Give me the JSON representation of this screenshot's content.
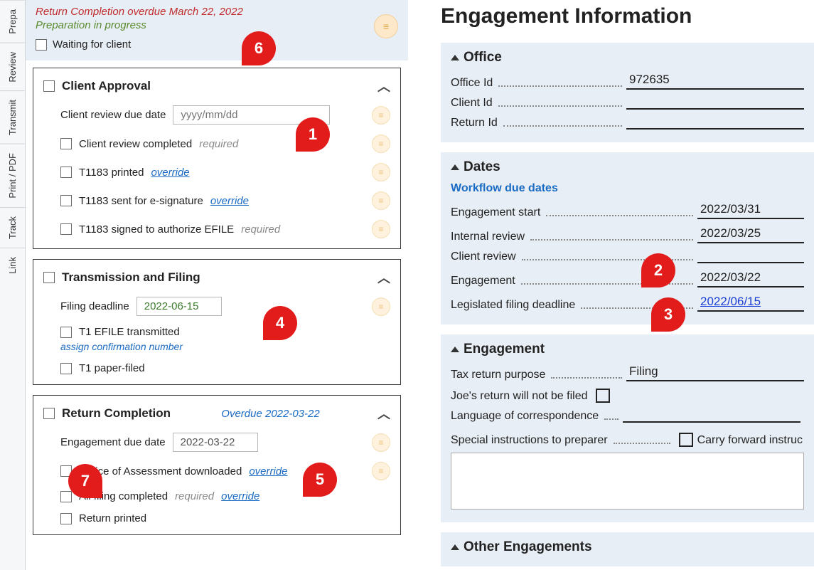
{
  "sideTabs": {
    "prepare": "Prepa",
    "review": "Review",
    "transmit": "Transmit",
    "printpdf": "Print / PDF",
    "track": "Track",
    "link": "Link"
  },
  "topStatus": {
    "overdue": "Return Completion overdue March 22, 2022",
    "progress": "Preparation in progress",
    "waiting": "Waiting for client"
  },
  "clientApproval": {
    "title": "Client Approval",
    "reviewDueLabel": "Client review due date",
    "reviewDuePlaceholder": "yyyy/mm/dd",
    "completed": "Client review completed",
    "t1183printed": "T1183 printed",
    "t1183esig": "T1183 sent for e-signature",
    "t1183signed": "T1183 signed to authorize EFILE",
    "required": "required",
    "override": "override"
  },
  "transmission": {
    "title": "Transmission and Filing",
    "deadlineLabel": "Filing deadline",
    "deadlineValue": "2022-06-15",
    "efile": "T1 EFILE transmitted",
    "assign": "assign confirmation number",
    "paper": "T1 paper-filed"
  },
  "completion": {
    "title": "Return Completion",
    "status": "Overdue 2022-03-22",
    "dueLabel": "Engagement due date",
    "dueValue": "2022-03-22",
    "noa": "Notice of Assessment downloaded",
    "allfiling": "All filing completed",
    "printed": "Return printed",
    "required": "required",
    "override": "override"
  },
  "info": {
    "heading": "Engagement Information",
    "office": {
      "title": "Office",
      "officeId": "Office Id",
      "officeIdVal": "972635",
      "clientId": "Client Id",
      "clientIdVal": "",
      "returnId": "Return Id",
      "returnIdVal": ""
    },
    "dates": {
      "title": "Dates",
      "sub": "Workflow due dates",
      "engStart": "Engagement start",
      "engStartVal": "2022/03/31",
      "internal": "Internal review",
      "internalVal": "2022/03/25",
      "clientReview": "Client review",
      "clientReviewVal": "",
      "engagement": "Engagement",
      "engagementVal": "2022/03/22",
      "legisl": "Legislated filing deadline",
      "legislVal": "2022/06/15"
    },
    "engagement": {
      "title": "Engagement",
      "purpose": "Tax return purpose",
      "purposeVal": "Filing",
      "notFiled": "Joe's return will not be filed",
      "lang": "Language of correspondence",
      "langVal": "",
      "special": "Special instructions to preparer",
      "carry": "Carry forward instruc"
    },
    "other": {
      "title": "Other Engagements"
    }
  },
  "callouts": {
    "c1": "1",
    "c2": "2",
    "c3": "3",
    "c4": "4",
    "c5": "5",
    "c6": "6",
    "c7": "7"
  }
}
